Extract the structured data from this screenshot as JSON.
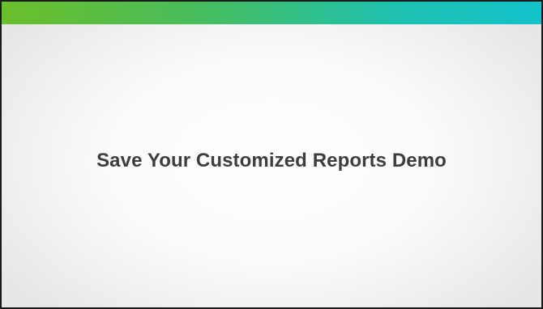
{
  "slide": {
    "title": "Save Your Customized Reports Demo",
    "accent_gradient": [
      "#6cbf2b",
      "#45bd5f",
      "#1fc0ae",
      "#12c3cc"
    ],
    "background_color": "#ffffff",
    "border_color": "#1a1a1a",
    "title_color": "#3d3d3d"
  }
}
